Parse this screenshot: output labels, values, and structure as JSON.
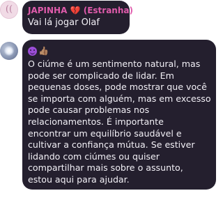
{
  "top_message": {
    "sender_name": "JAPINHA",
    "sender_heart": "💔",
    "sender_tag": "(Estranha)",
    "avatar_glyph": "(( ",
    "text": "Vai lá jogar Olaf"
  },
  "reply_message": {
    "emojis": [
      "smiling-imp-emoji",
      "thumbs-up-emoji"
    ],
    "thumb_glyph": "👍🏽",
    "lines": [
      "O ciúme é um sentimento natural, mas",
      "pode ser complicado de lidar. Em",
      "pequenas doses, pode mostrar que você",
      "se importa com alguém, mas em excesso",
      "pode causar problemas nos",
      "relacionamentos. É importante",
      "encontrar um equilíbrio saudável e",
      "cultivar a confiança mútua. Se estiver",
      "lidando com ciúmes ou quiser",
      "compartilhar mais sobre o assunto,",
      "estou aqui para ajudar."
    ]
  },
  "colors": {
    "bubble_bg": "#241f2e",
    "sender_name": "#df5bab",
    "message_text": "#f2f0f6"
  }
}
